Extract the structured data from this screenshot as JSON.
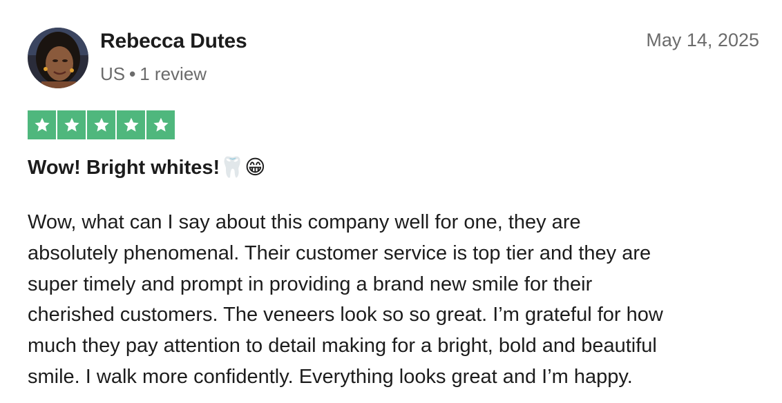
{
  "reviewer": {
    "name": "Rebecca Dutes",
    "country": "US",
    "separator": "•",
    "review_count": "1 review"
  },
  "review": {
    "date": "May 14, 2025",
    "rating": 5,
    "rating_max": 5,
    "star_color": "#4fb77d",
    "title": "Wow! Bright whites!🦷😁",
    "body_lines": [
      "Wow, what can I say about this company well for one, they are",
      "absolutely phenomenal. Their customer service is top tier and they are",
      "super timely and prompt in providing a brand new smile for their",
      "cherished customers. The veneers look so so great. I’m grateful for how",
      "much they pay attention to detail making for a bright, bold and beautiful",
      "smile. I walk more confidently. Everything looks great and I’m happy."
    ]
  }
}
